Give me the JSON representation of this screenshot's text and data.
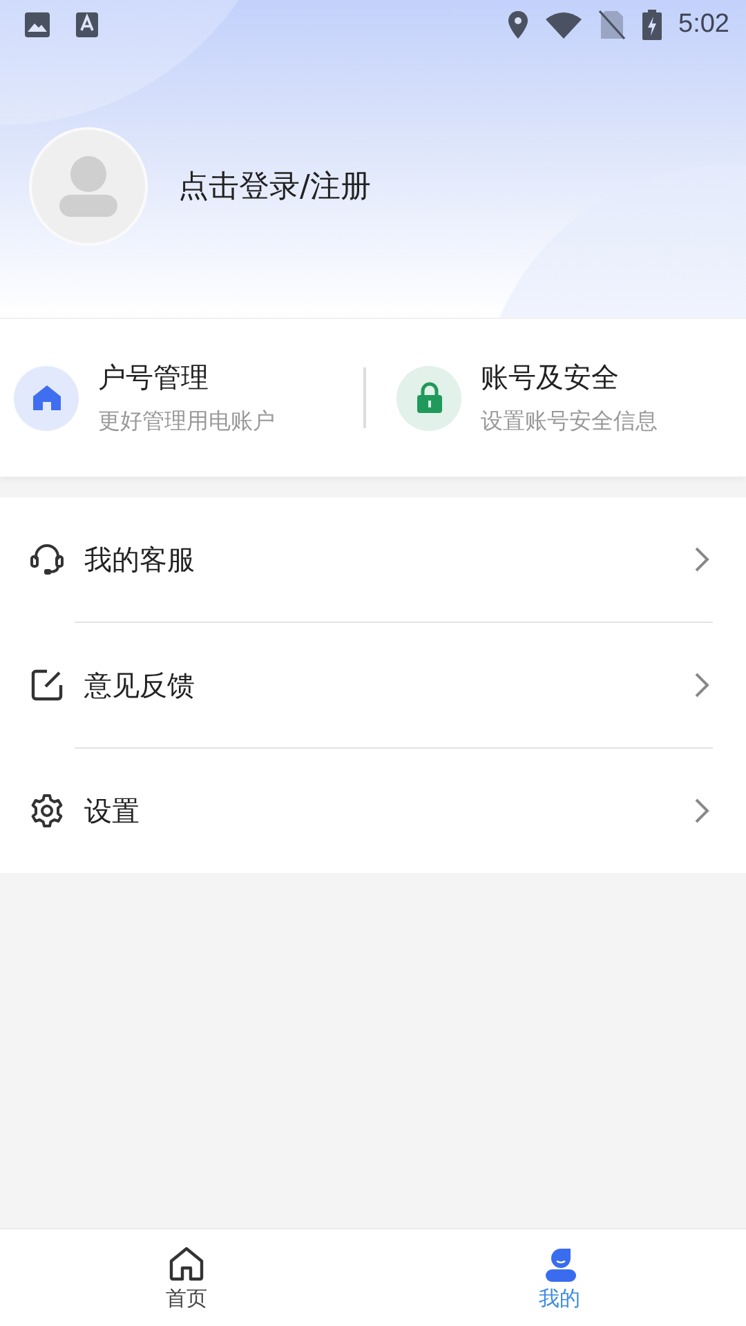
{
  "status_bar": {
    "time": "5:02"
  },
  "profile": {
    "login_text": "点击登录/注册"
  },
  "quick_cards": [
    {
      "title": "户号管理",
      "subtitle": "更好管理用电账户"
    },
    {
      "title": "账号及安全",
      "subtitle": "设置账号安全信息"
    }
  ],
  "menu": [
    {
      "label": "我的客服"
    },
    {
      "label": "意见反馈"
    },
    {
      "label": "设置"
    }
  ],
  "tabs": [
    {
      "label": "首页",
      "selected": false
    },
    {
      "label": "我的",
      "selected": true
    }
  ]
}
